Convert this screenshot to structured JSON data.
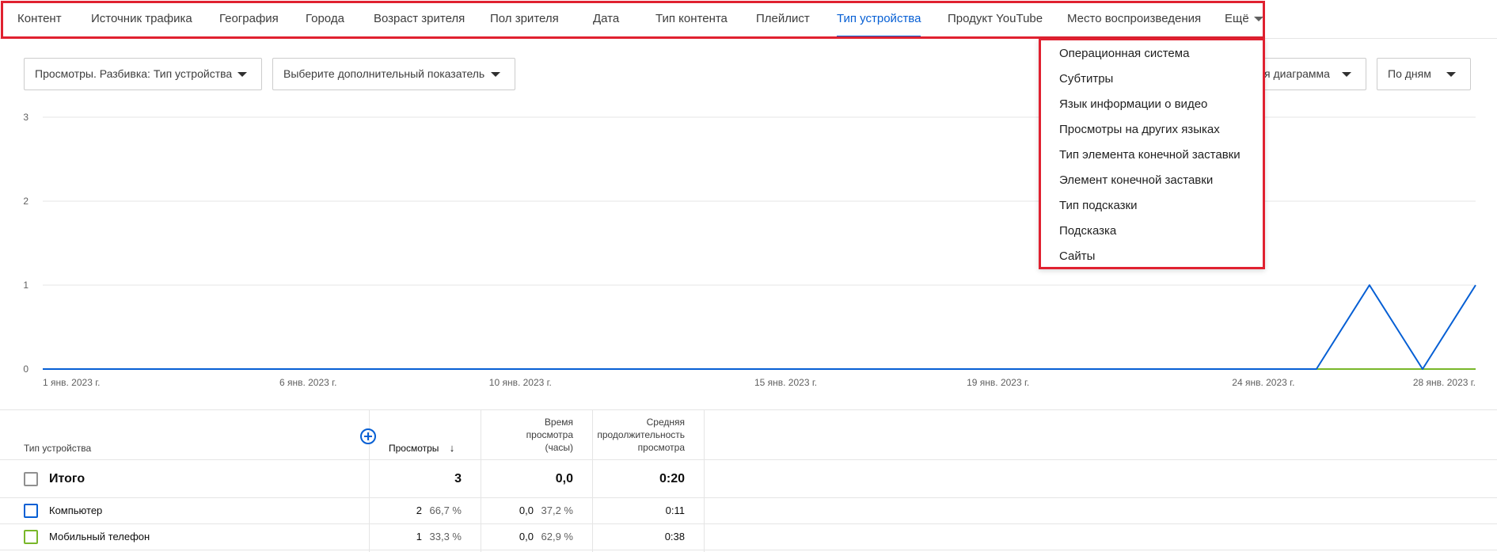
{
  "tabs": [
    {
      "label": "Контент"
    },
    {
      "label": "Источник трафика"
    },
    {
      "label": "География"
    },
    {
      "label": "Города"
    },
    {
      "label": "Возраст зрителя"
    },
    {
      "label": "Пол зрителя"
    },
    {
      "label": "Дата"
    },
    {
      "label": "Тип контента"
    },
    {
      "label": "Плейлист"
    },
    {
      "label": "Тип устройства",
      "active": true
    },
    {
      "label": "Продукт YouTube"
    },
    {
      "label": "Место воспроизведения"
    }
  ],
  "more_tab": {
    "label": "Ещё"
  },
  "dropdowns": {
    "metric": "Просмотры. Разбивка: Тип устройства",
    "extra_metric": "Выберите дополнительный показатель",
    "chart_type": "я диаграмма",
    "granularity": "По дням"
  },
  "more_menu": {
    "items": [
      "Операционная система",
      "Субтитры",
      "Язык информации о видео",
      "Просмотры на других языках",
      "Тип элемента конечной заставки",
      "Элемент конечной заставки",
      "Тип подсказки",
      "Подсказка",
      "Сайты"
    ]
  },
  "chart_data": {
    "type": "line",
    "x_tick_labels": [
      "1 янв. 2023 г.",
      "6 янв. 2023 г.",
      "10 янв. 2023 г.",
      "15 янв. 2023 г.",
      "19 янв. 2023 г.",
      "24 янв. 2023 г.",
      "28 янв. 2023 г."
    ],
    "y_ticks": [
      0,
      1,
      2,
      3
    ],
    "ylim": [
      0,
      3
    ],
    "x_start": "2023-01-01",
    "x_end": "2023-01-28",
    "grid": true,
    "series": [
      {
        "color": "#065fd4",
        "values": [
          0,
          0,
          0,
          0,
          0,
          0,
          0,
          0,
          0,
          0,
          0,
          0,
          0,
          0,
          0,
          0,
          0,
          0,
          0,
          0,
          0,
          0,
          0,
          0,
          0,
          1,
          0,
          1
        ]
      },
      {
        "color": "#79b72a",
        "values": [
          0,
          0,
          0,
          0,
          0,
          0,
          0,
          0,
          0,
          0,
          0,
          0,
          0,
          0,
          0,
          0,
          0,
          0,
          0,
          0,
          0,
          0,
          0,
          0,
          0,
          0,
          0,
          0
        ]
      }
    ]
  },
  "table": {
    "headers": {
      "device": "Тип устройства",
      "views": "Просмотры",
      "watch_time": [
        "Время",
        "просмотра",
        "(часы)"
      ],
      "avg_duration": [
        "Средняя",
        "продолжительность",
        "просмотра"
      ]
    },
    "total": {
      "label": "Итого",
      "views": "3",
      "watch_time": "0,0",
      "avg_duration": "0:20"
    },
    "rows": [
      {
        "label": "Компьютер",
        "color": "#065fd4",
        "views": "2",
        "views_pct": "66,7 %",
        "watch_time": "0,0",
        "watch_pct": "37,2 %",
        "avg_duration": "0:11"
      },
      {
        "label": "Мобильный телефон",
        "color": "#79b72a",
        "views": "1",
        "views_pct": "33,3 %",
        "watch_time": "0,0",
        "watch_pct": "62,9 %",
        "avg_duration": "0:38"
      }
    ]
  }
}
